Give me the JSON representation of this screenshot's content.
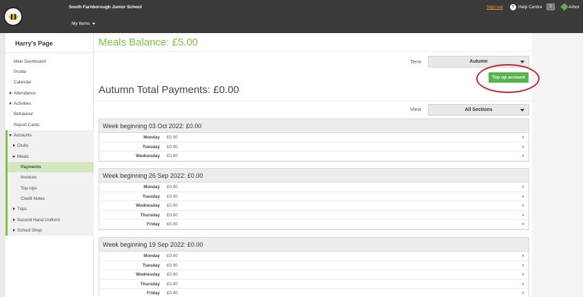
{
  "header": {
    "school_name": "South Farnborough Junior School",
    "my_items": "My Items",
    "sign_out": "Sign out",
    "help_centre": "Help Centre",
    "notification_count": "0",
    "brand": "Arbor"
  },
  "sidebar": {
    "title": "Harry's Page",
    "items": [
      {
        "label": "Main Dashboard"
      },
      {
        "label": "Profile"
      },
      {
        "label": "Calendar"
      },
      {
        "label": "Attendance"
      },
      {
        "label": "Activities"
      },
      {
        "label": "Behaviour"
      },
      {
        "label": "Report Cards"
      },
      {
        "label": "Accounts"
      },
      {
        "label": "Clubs"
      },
      {
        "label": "Meals"
      },
      {
        "label": "Payments"
      },
      {
        "label": "Invoices"
      },
      {
        "label": "Top-Ups"
      },
      {
        "label": "Credit Notes"
      },
      {
        "label": "Trips"
      },
      {
        "label": "Second Hand Uniform"
      },
      {
        "label": "School Shop"
      }
    ]
  },
  "main": {
    "balance": "Meals Balance: £5.00",
    "term_label": "Term",
    "term_value": "Autumn",
    "topup_label": "Top up account",
    "total": "Autumn Total Payments: £0.00",
    "view_label": "View",
    "view_value": "All Sections",
    "weeks": [
      {
        "title": "Week beginning 03 Oct 2022: £0.00",
        "rows": [
          {
            "day": "Monday",
            "amount": "£0.00"
          },
          {
            "day": "Tuesday",
            "amount": "£0.00"
          },
          {
            "day": "Wednesday",
            "amount": "£0.00"
          }
        ]
      },
      {
        "title": "Week beginning 26 Sep 2022: £0.00",
        "rows": [
          {
            "day": "Monday",
            "amount": "£0.00"
          },
          {
            "day": "Tuesday",
            "amount": "£0.00"
          },
          {
            "day": "Wednesday",
            "amount": "£0.00"
          },
          {
            "day": "Thursday",
            "amount": "£0.00"
          },
          {
            "day": "Friday",
            "amount": "£0.00"
          }
        ]
      },
      {
        "title": "Week beginning 19 Sep 2022: £0.00",
        "rows": [
          {
            "day": "Monday",
            "amount": "£0.00"
          },
          {
            "day": "Tuesday",
            "amount": "£0.00"
          },
          {
            "day": "Wednesday",
            "amount": "£0.00"
          },
          {
            "day": "Thursday",
            "amount": "£0.00"
          },
          {
            "day": "Friday",
            "amount": "£0.00"
          }
        ]
      }
    ]
  },
  "colors": {
    "accent_green": "#7bc142",
    "button_green": "#54b548",
    "highlight_ring": "#c0262d",
    "topbar": "#3a3a3a"
  }
}
